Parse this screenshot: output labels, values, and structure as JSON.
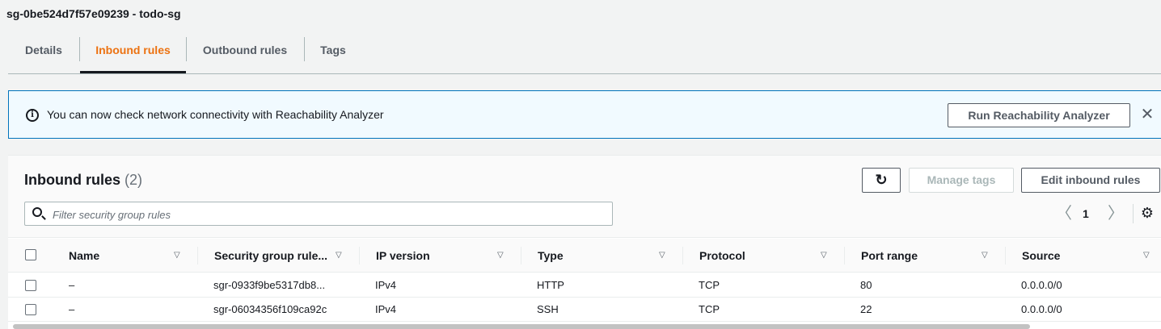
{
  "page": {
    "title": "sg-0be524d7f57e09239 - todo-sg"
  },
  "tabs": [
    {
      "label": "Details",
      "active": false
    },
    {
      "label": "Inbound rules",
      "active": true
    },
    {
      "label": "Outbound rules",
      "active": false
    },
    {
      "label": "Tags",
      "active": false
    }
  ],
  "flash": {
    "message": "You can now check network connectivity with Reachability Analyzer",
    "button_label": "Run Reachability Analyzer",
    "close_glyph": "✕",
    "icon": "info-icon"
  },
  "panel": {
    "title": "Inbound rules",
    "count": "(2)",
    "refresh_glyph": "↻",
    "manage_tags_label": "Manage tags",
    "edit_label": "Edit inbound rules",
    "search_placeholder": "Filter security group rules",
    "search_value": "",
    "pager": {
      "prev_glyph": "〈",
      "page": "1",
      "next_glyph": "〉"
    },
    "settings_glyph": "⚙"
  },
  "table": {
    "columns": [
      "Name",
      "Security group rule...",
      "IP version",
      "Type",
      "Protocol",
      "Port range",
      "Source"
    ],
    "sort_glyph": "▽",
    "rows": [
      {
        "name": "–",
        "rule_id": "sgr-0933f9be5317db8...",
        "ip_version": "IPv4",
        "type": "HTTP",
        "protocol": "TCP",
        "port_range": "80",
        "source": "0.0.0.0/0"
      },
      {
        "name": "–",
        "rule_id": "sgr-06034356f109ca92c",
        "ip_version": "IPv4",
        "type": "SSH",
        "protocol": "TCP",
        "port_range": "22",
        "source": "0.0.0.0/0"
      }
    ]
  },
  "colors": {
    "accent": "#ec7211",
    "info_border": "#0073bb",
    "info_bg": "#f1faff"
  }
}
